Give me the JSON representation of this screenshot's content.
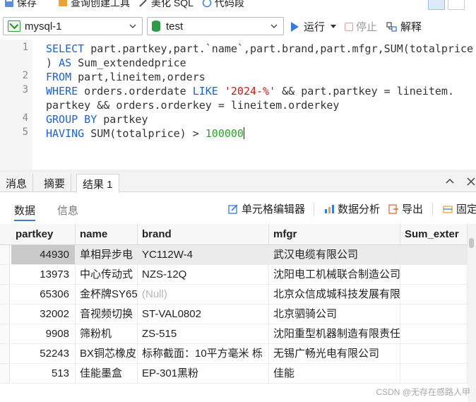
{
  "toolbar": {
    "save": "保存",
    "query_builder": "查询创建工具",
    "beautify": "美化 SQL",
    "snippets": "代码段"
  },
  "connection": {
    "selected": "mysql-1"
  },
  "database": {
    "selected": "test"
  },
  "actions": {
    "run": "运行",
    "stop": "停止",
    "explain": "解释"
  },
  "editor": {
    "line_numbers": [
      "1",
      "2",
      "3",
      "4",
      "5"
    ],
    "l1a": "SELECT",
    "l1b": " part.partkey,part.`name`,part.brand,part.mfgr,SUM(totalprice",
    "l1c_kw": ") AS",
    "l1d": " Sum_extendedprice",
    "l2a": "FROM",
    "l2b": " part,lineitem,orders",
    "l3a": "WHERE",
    "l3b": " orders.orderdate ",
    "l3c": "LIKE",
    "l3d": " ",
    "l3e": "'2024-%'",
    "l3f": " && part.partkey = lineitem.",
    "l3g": "partkey && orders.orderkey = lineitem.orderkey",
    "l4a": "GROUP BY",
    "l4b": " partkey",
    "l5a": "HAVING",
    "l5b": " SUM(totalprice) > ",
    "l5c": "100000"
  },
  "result_tabs": {
    "messages": "消息",
    "summary": "摘要",
    "result1": "结果 1"
  },
  "subtabs": {
    "data": "数据",
    "info": "信息"
  },
  "grid_actions": {
    "cell_editor": "单元格编辑器",
    "data_analysis": "数据分析",
    "export": "导出",
    "pin": "固定"
  },
  "columns": [
    "partkey",
    "name",
    "brand",
    "mfgr",
    "Sum_exter"
  ],
  "rows": [
    {
      "partkey": "44930",
      "name": "单相异步电",
      "brand": "YC112W-4",
      "mfgr": "武汉电缆有限公司"
    },
    {
      "partkey": "13973",
      "name": "中心传动式",
      "brand": "NZS-12Q",
      "mfgr": "沈阳电工机械联合制造公司"
    },
    {
      "partkey": "65306",
      "name": "金杯牌SY65",
      "brand": "(Null)",
      "mfgr": "北京众信成城科技发展有限"
    },
    {
      "partkey": "32002",
      "name": "音视频切换",
      "brand": "ST-VAL0802",
      "mfgr": "北京驷骑公司"
    },
    {
      "partkey": "9908",
      "name": "筛粉机",
      "brand": "ZS-515",
      "mfgr": "沈阳重型机器制造有限责任"
    },
    {
      "partkey": "52243",
      "name": "BX铜芯橡皮",
      "brand": "标称截面：10平方毫米 栎",
      "mfgr": "无锡广畅光电有限公司"
    },
    {
      "partkey": "513",
      "name": "佳能墨盒",
      "brand": "EP-301黑粉",
      "mfgr": "佳能"
    }
  ],
  "watermark": "CSDN @无存在感路人甲"
}
